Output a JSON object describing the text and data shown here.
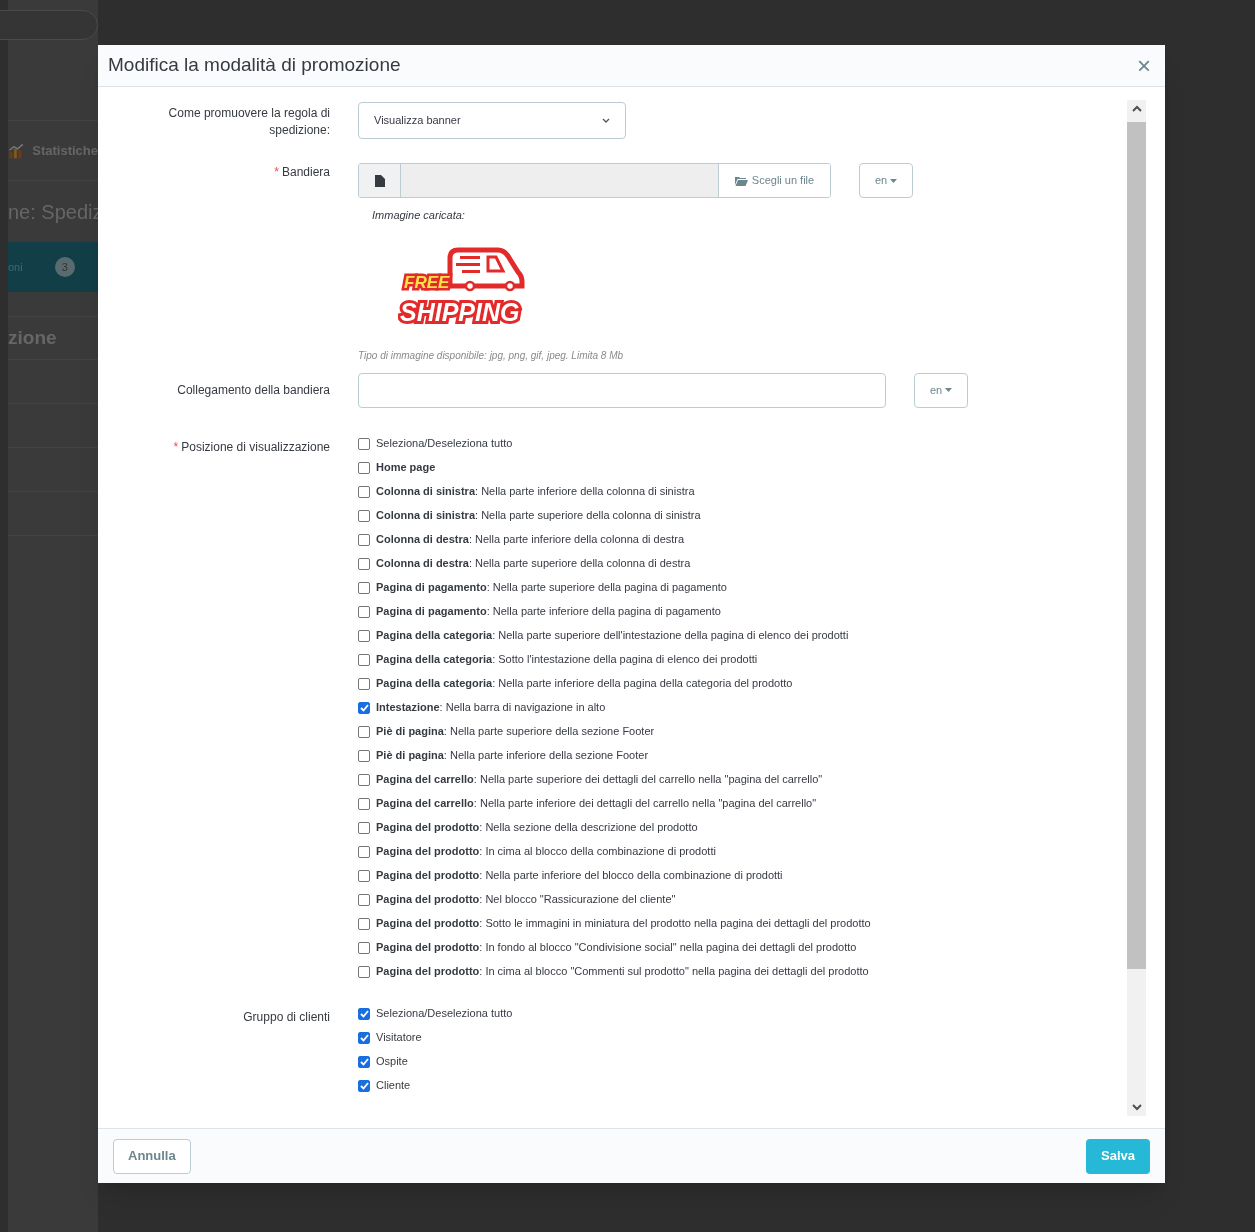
{
  "background": {
    "menu_item": "Statistiche",
    "page_title": "ne: Spediz",
    "step_label": "oni",
    "step_number": "3",
    "section_title": "zione"
  },
  "dialog": {
    "title": "Modifica la modalità di promozione",
    "close": "×",
    "promote": {
      "label": "Come promuovere la regola di spedizione:",
      "value": "Visualizza banner"
    },
    "banner": {
      "label": "Bandiera",
      "required_mark": "*",
      "button": "Scegli un file",
      "lang": "en",
      "uploaded_label": "Immagine caricata:",
      "image_text": [
        "FREE",
        "SHIPPING"
      ],
      "hint": "Tipo di immagine disponibile: jpg, png, gif, jpeg. Limita 8 Mb"
    },
    "link": {
      "label": "Collegamento della bandiera",
      "lang": "en"
    },
    "positions": {
      "label": "Posizione di visualizzazione",
      "required_mark": "*",
      "items": [
        {
          "label": "Seleziona/Deseleziona tutto",
          "checked": false
        },
        {
          "label": "**Home page**",
          "checked": false
        },
        {
          "label": "**Colonna di sinistra**: Nella parte inferiore della colonna di sinistra",
          "checked": false
        },
        {
          "label": "**Colonna di sinistra**: Nella parte superiore della colonna di sinistra",
          "checked": false
        },
        {
          "label": "**Colonna di destra**: Nella parte inferiore della colonna di destra",
          "checked": false
        },
        {
          "label": "**Colonna di destra**: Nella parte superiore della colonna di destra",
          "checked": false
        },
        {
          "label": "**Pagina di pagamento**: Nella parte superiore della pagina di pagamento",
          "checked": false
        },
        {
          "label": "**Pagina di pagamento**: Nella parte inferiore della pagina di pagamento",
          "checked": false
        },
        {
          "label": "**Pagina della categoria**: Nella parte superiore dell'intestazione della pagina di elenco dei prodotti",
          "checked": false
        },
        {
          "label": "**Pagina della categoria**: Sotto l'intestazione della pagina di elenco dei prodotti",
          "checked": false
        },
        {
          "label": "**Pagina della categoria**: Nella parte inferiore della pagina della categoria del prodotto",
          "checked": false
        },
        {
          "label": "**Intestazione**: Nella barra di navigazione in alto",
          "checked": true
        },
        {
          "label": "**Piè di pagina**: Nella parte superiore della sezione Footer",
          "checked": false
        },
        {
          "label": "**Piè di pagina**: Nella parte inferiore della sezione Footer",
          "checked": false
        },
        {
          "label": "**Pagina del carrello**: Nella parte superiore dei dettagli del carrello nella \"pagina del carrello\"",
          "checked": false
        },
        {
          "label": "**Pagina del carrello**: Nella parte inferiore dei dettagli del carrello nella \"pagina del carrello\"",
          "checked": false
        },
        {
          "label": "**Pagina del prodotto**: Nella sezione della descrizione del prodotto",
          "checked": false
        },
        {
          "label": "**Pagina del prodotto**: In cima al blocco della combinazione di prodotti",
          "checked": false
        },
        {
          "label": "**Pagina del prodotto**: Nella parte inferiore del blocco della combinazione di prodotti",
          "checked": false
        },
        {
          "label": "**Pagina del prodotto**: Nel blocco \"Rassicurazione del cliente\"",
          "checked": false
        },
        {
          "label": "**Pagina del prodotto**: Sotto le immagini in miniatura del prodotto nella pagina dei dettagli del prodotto",
          "checked": false
        },
        {
          "label": "**Pagina del prodotto**: In fondo al blocco \"Condivisione social\" nella pagina dei dettagli del prodotto",
          "checked": false
        },
        {
          "label": "**Pagina del prodotto**: In cima al blocco \"Commenti sul prodotto\" nella pagina dei dettagli del prodotto",
          "checked": false
        }
      ]
    },
    "groups": {
      "label": "Gruppo di clienti",
      "items": [
        {
          "label": "Seleziona/Deseleziona tutto",
          "checked": true
        },
        {
          "label": "Visitatore",
          "checked": true
        },
        {
          "label": "Ospite",
          "checked": true
        },
        {
          "label": "Cliente",
          "checked": true
        }
      ]
    },
    "cancel": "Annulla",
    "save": "Salva"
  }
}
